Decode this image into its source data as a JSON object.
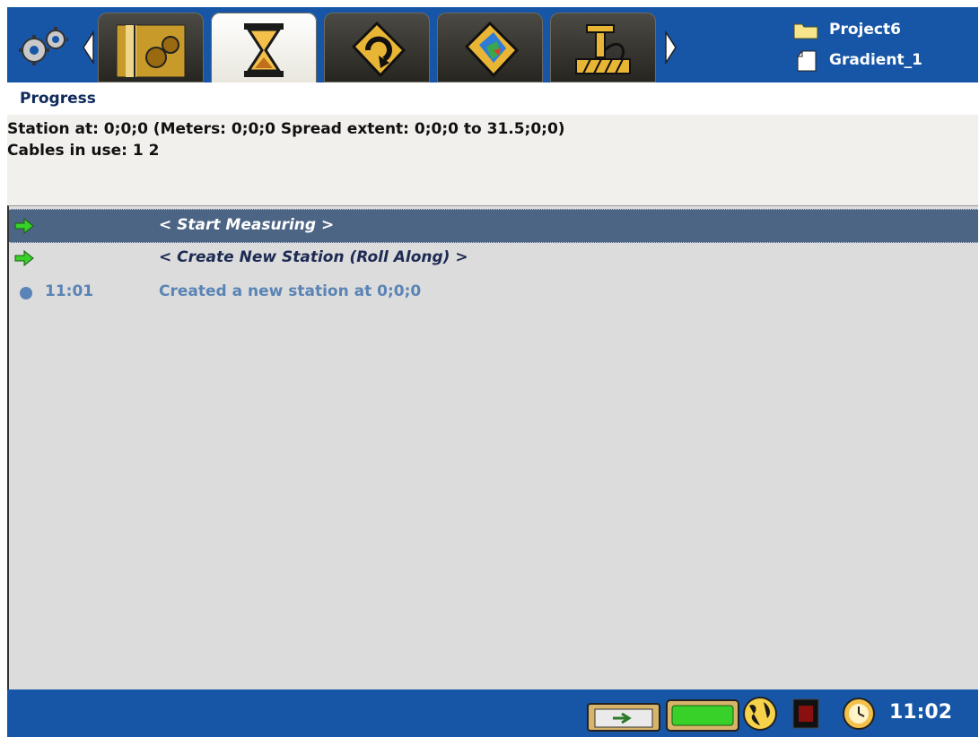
{
  "header": {
    "tabs": [
      {
        "icon": "gear-toolbox-icon",
        "active": false
      },
      {
        "icon": "hourglass-icon",
        "active": true
      },
      {
        "icon": "rotate-cycle-icon",
        "active": false
      },
      {
        "icon": "map-gradient-icon",
        "active": false
      },
      {
        "icon": "cable-spool-icon",
        "active": false
      }
    ],
    "project_name": "Project6",
    "file_name": "Gradient_1"
  },
  "title": "Progress",
  "info": {
    "line1": "Station at: 0;0;0 (Meters: 0;0;0 Spread extent: 0;0;0 to 31.5;0;0)",
    "line2": "Cables in use: 1 2"
  },
  "list": {
    "actions": [
      {
        "label": "< Start Measuring >",
        "selected": true
      },
      {
        "label": "< Create New Station (Roll Along) >",
        "selected": false
      }
    ],
    "log": [
      {
        "time": "11:01",
        "text": "Created a new station  at 0;0;0"
      }
    ]
  },
  "statusbar": {
    "icons": [
      "power-plug-icon",
      "battery-icon",
      "globe-icon",
      "record-stop-icon",
      "clock-icon"
    ],
    "time": "11:02"
  },
  "colors": {
    "bar_blue": "#1756a6",
    "selected_row": "#4d6584",
    "log_text": "#5a84b5",
    "list_bg": "#dcdcdc"
  }
}
